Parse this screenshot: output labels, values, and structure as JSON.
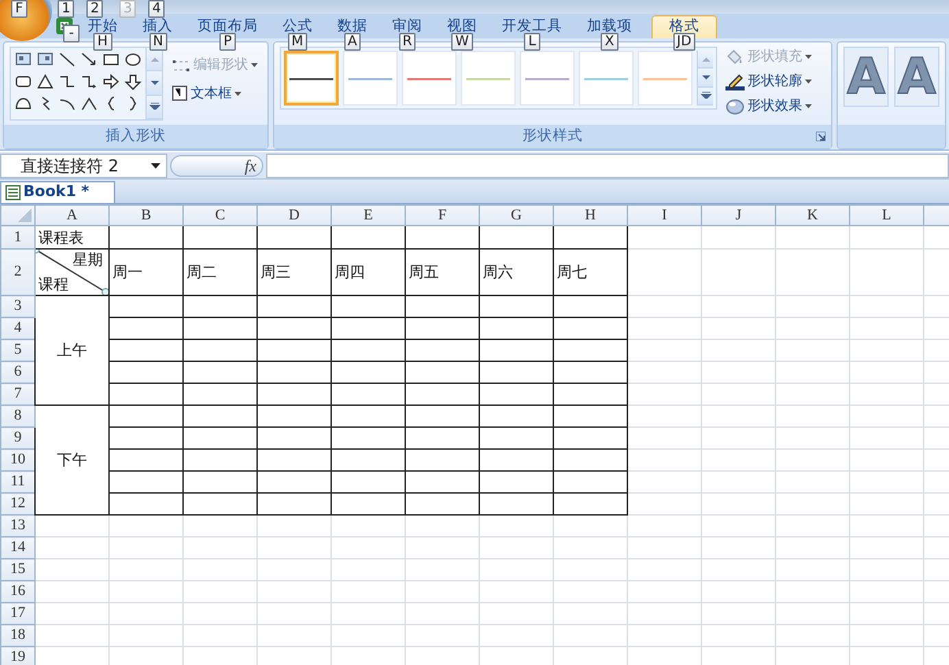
{
  "office_button": {
    "key_tip": "F"
  },
  "quick_access_key_tips": [
    {
      "label": "1",
      "disabled": false
    },
    {
      "label": "2",
      "disabled": false
    },
    {
      "label": "3",
      "disabled": true
    },
    {
      "label": "4",
      "disabled": false
    }
  ],
  "app_icon_key_tip": "-",
  "tabs": [
    {
      "label": "开始",
      "key_tip": "H",
      "selected": false
    },
    {
      "label": "插入",
      "key_tip": "N",
      "selected": false
    },
    {
      "label": "页面布局",
      "key_tip": "P",
      "selected": false
    },
    {
      "label": "公式",
      "key_tip": "M",
      "selected": false
    },
    {
      "label": "数据",
      "key_tip": "A",
      "selected": false
    },
    {
      "label": "审阅",
      "key_tip": "R",
      "selected": false
    },
    {
      "label": "视图",
      "key_tip": "W",
      "selected": false
    },
    {
      "label": "开发工具",
      "key_tip": "L",
      "selected": false
    },
    {
      "label": "加载项",
      "key_tip": "X",
      "selected": false
    },
    {
      "label": "格式",
      "key_tip": "JD",
      "selected": true
    }
  ],
  "insert_shapes": {
    "label": "插入形状",
    "buttons": [
      {
        "kind": "edit",
        "label": "编辑形状",
        "disabled": true
      },
      {
        "kind": "textbox",
        "label": "文本框",
        "disabled": false
      }
    ]
  },
  "shape_styles": {
    "label": "形状样式",
    "styles": [
      {
        "color": "#404040",
        "selected": true
      },
      {
        "color": "#95b3d7",
        "selected": false
      },
      {
        "color": "#e46c6c",
        "selected": false
      },
      {
        "color": "#c3d69b",
        "selected": false
      },
      {
        "color": "#b3a2c7",
        "selected": false
      },
      {
        "color": "#93cddd",
        "selected": false
      },
      {
        "color": "#fabf8f",
        "selected": false
      }
    ],
    "commands": [
      {
        "kind": "fill",
        "label": "形状填充",
        "disabled": true
      },
      {
        "kind": "outline",
        "label": "形状轮廓",
        "disabled": false
      },
      {
        "kind": "effect",
        "label": "形状效果",
        "disabled": false
      }
    ]
  },
  "wordart_styles": [
    {
      "label": "A"
    },
    {
      "label": "A"
    }
  ],
  "formula_bar": {
    "name_box": "直接连接符 2",
    "function_symbol": "fx"
  },
  "workbook_tab": "Book1 *",
  "sheet": {
    "column_letters": [
      "A",
      "B",
      "C",
      "D",
      "E",
      "F",
      "G",
      "H",
      "I",
      "J",
      "K",
      "L"
    ],
    "row_numbers": [
      "1",
      "2",
      "3",
      "4",
      "5",
      "6",
      "7",
      "8",
      "9",
      "10",
      "11",
      "12",
      "13",
      "14",
      "15",
      "16",
      "17",
      "18",
      "19"
    ],
    "title": "课程表",
    "corner_top": "星期",
    "corner_bottom": "课程",
    "days": [
      "周一",
      "周二",
      "周三",
      "周四",
      "周五",
      "周六",
      "周七"
    ],
    "periods": [
      {
        "label": "上午"
      },
      {
        "label": "下午"
      }
    ]
  }
}
